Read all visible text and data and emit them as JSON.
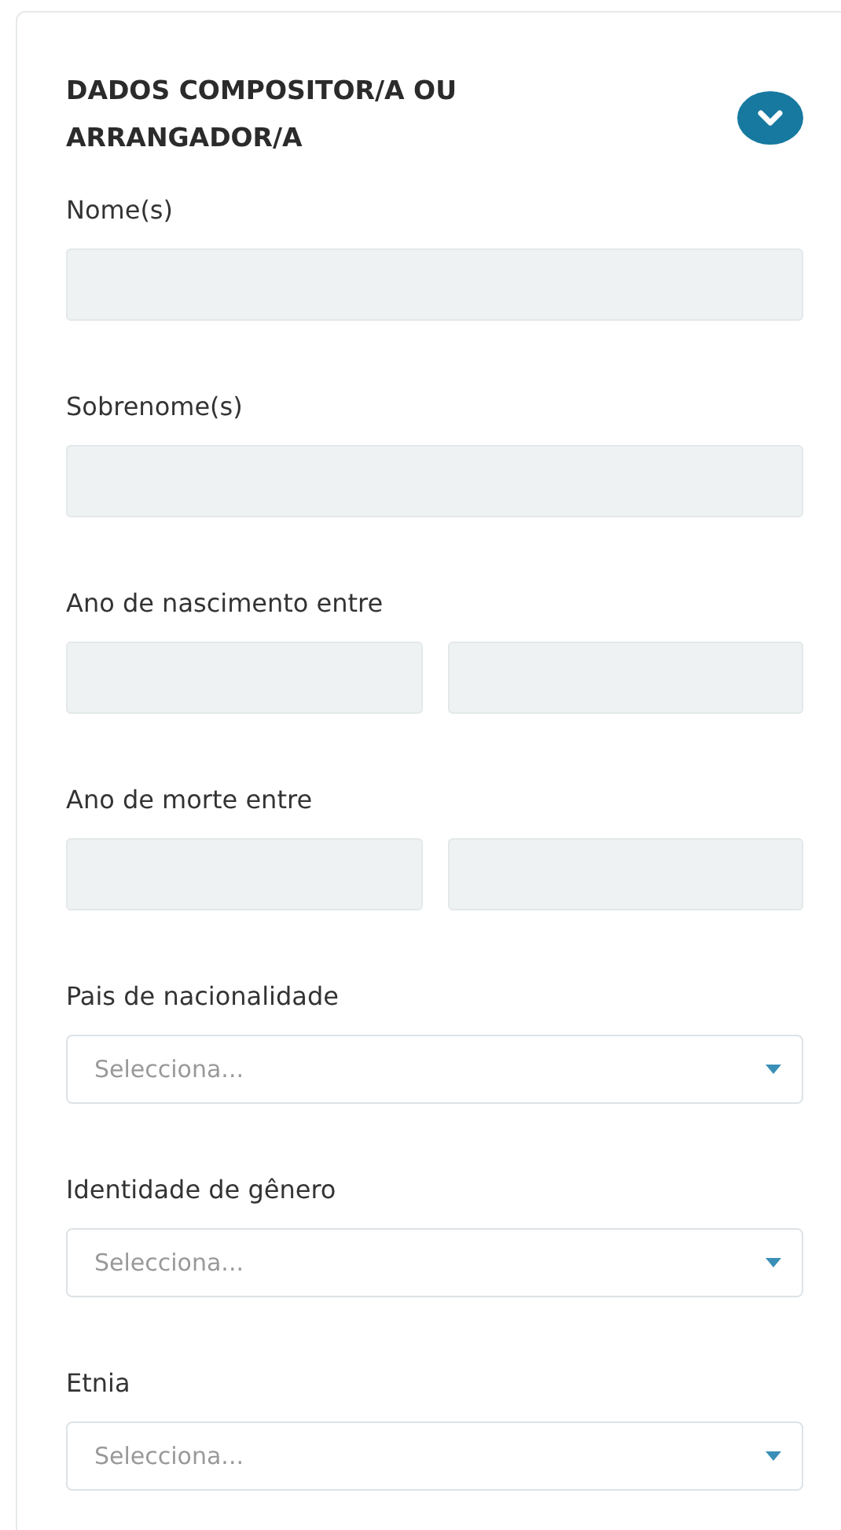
{
  "panel": {
    "title": "DADOS COMPOSITOR/A OU ARRANGADOR/A"
  },
  "fields": [
    {
      "kind": "text",
      "label": "Nome(s)"
    },
    {
      "kind": "text",
      "label": "Sobrenome(s)"
    },
    {
      "kind": "range",
      "label": "Ano de nascimento entre"
    },
    {
      "kind": "range",
      "label": "Ano de morte entre"
    },
    {
      "kind": "select",
      "label": "Pais de nacionalidade",
      "placeholder": "Selecciona..."
    },
    {
      "kind": "select",
      "label": "Identidade de gênero",
      "placeholder": "Selecciona..."
    },
    {
      "kind": "select",
      "label": "Etnia",
      "placeholder": "Selecciona..."
    }
  ]
}
